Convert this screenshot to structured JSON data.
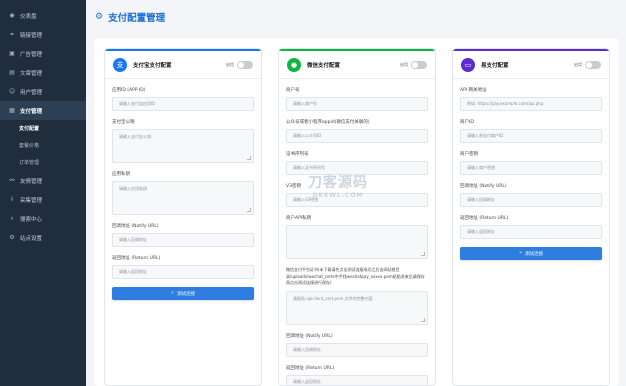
{
  "sidebar": {
    "items": [
      {
        "label": "仪表盘",
        "icon": "dashboard-icon",
        "glyph": "◉"
      },
      {
        "label": "链接管理",
        "icon": "link-icon",
        "glyph": "⚭"
      },
      {
        "label": "广告管理",
        "icon": "ad-icon",
        "glyph": "▣"
      },
      {
        "label": "文章管理",
        "icon": "document-icon",
        "glyph": "▤"
      },
      {
        "label": "用户管理",
        "icon": "user-icon",
        "glyph": "☺"
      },
      {
        "label": "支付管理",
        "icon": "payment-icon",
        "glyph": "▦"
      }
    ],
    "sub_items": [
      {
        "label": "支付配置"
      },
      {
        "label": "套餐价格"
      },
      {
        "label": "订单管理"
      }
    ],
    "items2": [
      {
        "label": "友情管理",
        "icon": "friend-link-icon",
        "glyph": "⚯"
      },
      {
        "label": "采集管理",
        "icon": "collect-icon",
        "glyph": "⇩"
      },
      {
        "label": "搜索中心",
        "icon": "search-icon",
        "glyph": "⌕"
      },
      {
        "label": "站点设置",
        "icon": "settings-icon",
        "glyph": "⚙"
      }
    ]
  },
  "header": {
    "title": "支付配置管理"
  },
  "alipay": {
    "title": "支付宝支付配置",
    "toggle_label": "启用",
    "color": "#1677ff",
    "appid_label": "应用ID (APP ID)",
    "appid_placeholder": "请输入支付宝应用ID",
    "pubkey_label": "支付宝公钥",
    "pubkey_placeholder": "请输入支付宝公钥",
    "privkey_label": "应用私钥",
    "privkey_placeholder": "请输入应用私钥",
    "notify_label": "回调地址 (Notify URL)",
    "notify_placeholder": "请输入回调地址",
    "return_label": "返回地址 (Return URL)",
    "return_placeholder": "请输入返回地址",
    "test_btn": "测试连接"
  },
  "wechat": {
    "title": "微信支付配置",
    "toggle_label": "启用",
    "color": "#09b83e",
    "mchid_label": "商户号",
    "mchid_placeholder": "请输入商户号",
    "appid_label": "公众号或者小程序appid(微信支付关联的)",
    "appid_placeholder": "请输入公众号ID",
    "serial_label": "证书序列号",
    "serial_placeholder": "请输入证书序列号",
    "v3_label": "V3密钥",
    "v3_placeholder": "请输入V3密钥",
    "privkey_label": "商户API私钥",
    "note": "微信支付平台证书(未下载请先点击测试连接成功之后去网站根目录/uploads/wechat_certs中手找wechatpay_xxxxx.pem粘贴进来后请保存再点击测试连接进行保存)",
    "cert_placeholder": "请粘贴 apiclient_cert.pem 文件的完整内容",
    "notify_label": "回调地址 (Notify URL)",
    "notify_placeholder": "请输入回调地址",
    "return_label": "返回地址 (Return URL)",
    "return_placeholder": "请输入返回地址"
  },
  "epay": {
    "title": "易支付配置",
    "toggle_label": "启用",
    "color": "#5b2ccf",
    "api_label": "API 网关地址",
    "api_placeholder": "例如: https://pay.example.com/api.php",
    "pid_label": "商户ID",
    "pid_placeholder": "请输入易支付商户ID",
    "key_label": "商户密钥",
    "key_placeholder": "请输入商户密钥",
    "notify_label": "回调地址 (Notify URL)",
    "notify_placeholder": "请输入回调地址",
    "return_label": "返回地址 (Return URL)",
    "return_placeholder": "请输入返回地址",
    "test_btn": "测试连接"
  },
  "watermark": {
    "line1": "刀客源码",
    "line2": "DKEWL.COM"
  }
}
